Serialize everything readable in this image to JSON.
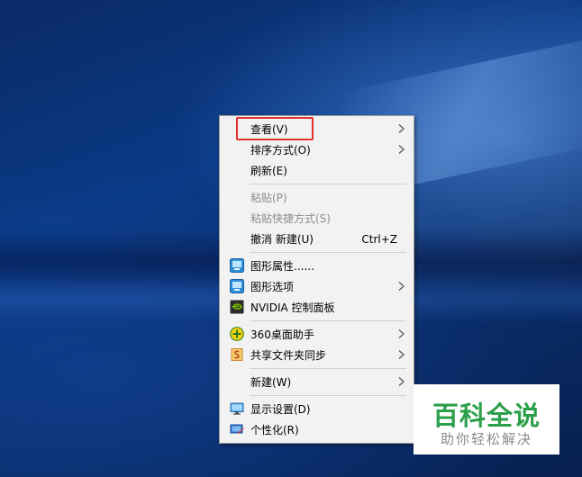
{
  "context_menu": {
    "items": [
      {
        "label": "查看(V)"
      },
      {
        "label": "排序方式(O)"
      },
      {
        "label": "刷新(E)"
      },
      {
        "label": "粘贴(P)"
      },
      {
        "label": "粘贴快捷方式(S)"
      },
      {
        "label": "撤消 新建(U)",
        "shortcut": "Ctrl+Z"
      },
      {
        "label": "图形属性......",
        "icon": "intel-graphics-icon"
      },
      {
        "label": "图形选项",
        "icon": "intel-graphics-icon"
      },
      {
        "label": "NVIDIA 控制面板",
        "icon": "nvidia-icon"
      },
      {
        "label": "360桌面助手",
        "icon": "360-icon"
      },
      {
        "label": "共享文件夹同步",
        "icon": "shared-folder-sync-icon"
      },
      {
        "label": "新建(W)"
      },
      {
        "label": "显示设置(D)",
        "icon": "display-icon"
      },
      {
        "label": "个性化(R)",
        "icon": "personalize-icon"
      }
    ]
  },
  "watermark": {
    "title": "百科全说",
    "subtitle": "助你轻松解决"
  },
  "colors": {
    "highlight_border": "#e0332c",
    "watermark_green": "#2c9f4b"
  }
}
